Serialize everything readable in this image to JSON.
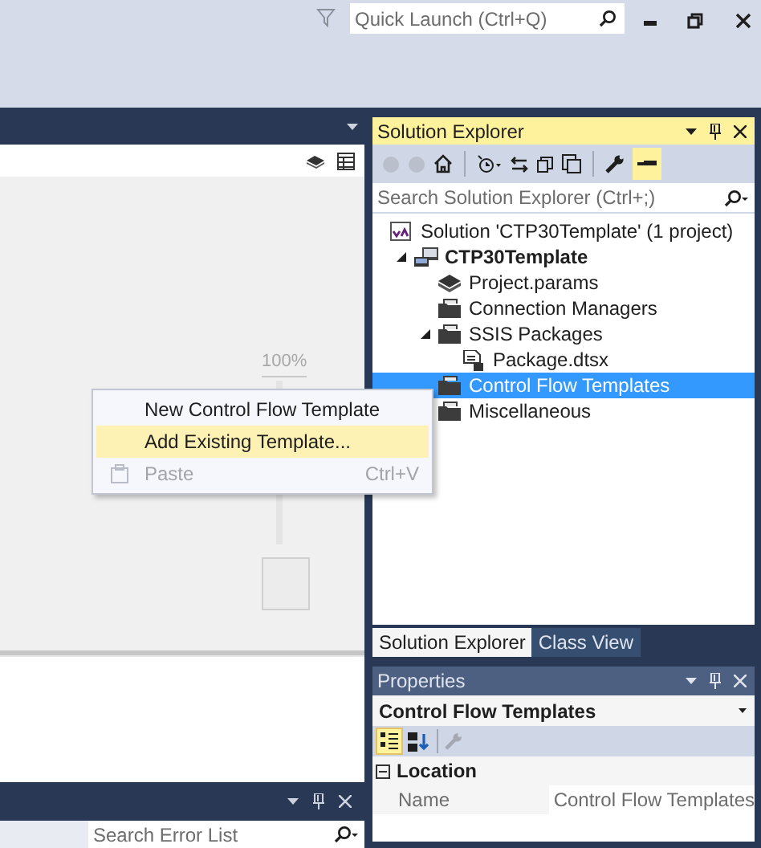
{
  "title_bar": {
    "quick_launch": {
      "placeholder": "Quick Launch (Ctrl+Q)"
    }
  },
  "designer": {
    "zoom_label": "100%"
  },
  "context_menu": [
    {
      "label": "New Control Flow Template",
      "selected": false,
      "disabled": false
    },
    {
      "label": "Add Existing Template...",
      "selected": true,
      "disabled": false
    },
    {
      "label": "Paste",
      "shortcut": "Ctrl+V",
      "selected": false,
      "disabled": true
    }
  ],
  "error_list": {
    "search": {
      "placeholder": "Search Error List"
    }
  },
  "solution_explorer": {
    "title": "Solution Explorer",
    "search": {
      "placeholder": "Search Solution Explorer (Ctrl+;)"
    },
    "tree": [
      {
        "label": "Solution 'CTP30Template' (1 project)",
        "kind": "solution",
        "selected": false,
        "children": [
          {
            "label": "CTP30Template",
            "kind": "project",
            "expanded": true,
            "selected": false,
            "children": [
              {
                "label": "Project.params",
                "kind": "params",
                "selected": false
              },
              {
                "label": "Connection Managers",
                "kind": "folder",
                "selected": false
              },
              {
                "label": "SSIS Packages",
                "kind": "folder",
                "expanded": true,
                "selected": false,
                "children": [
                  {
                    "label": "Package.dtsx",
                    "kind": "package",
                    "selected": false
                  }
                ]
              },
              {
                "label": "Control Flow Templates",
                "kind": "folder",
                "selected": true
              },
              {
                "label": "Miscellaneous",
                "kind": "folder",
                "selected": false
              }
            ]
          }
        ]
      }
    ]
  },
  "panel_tabs": [
    {
      "label": "Solution Explorer",
      "selected": true
    },
    {
      "label": "Class View",
      "selected": false
    }
  ],
  "properties": {
    "title": "Properties",
    "object": "Control Flow Templates",
    "categories": [
      {
        "name": "Location",
        "expanded": true,
        "rows": [
          {
            "name": "Name",
            "value": "Control Flow Templates"
          }
        ]
      }
    ]
  }
}
